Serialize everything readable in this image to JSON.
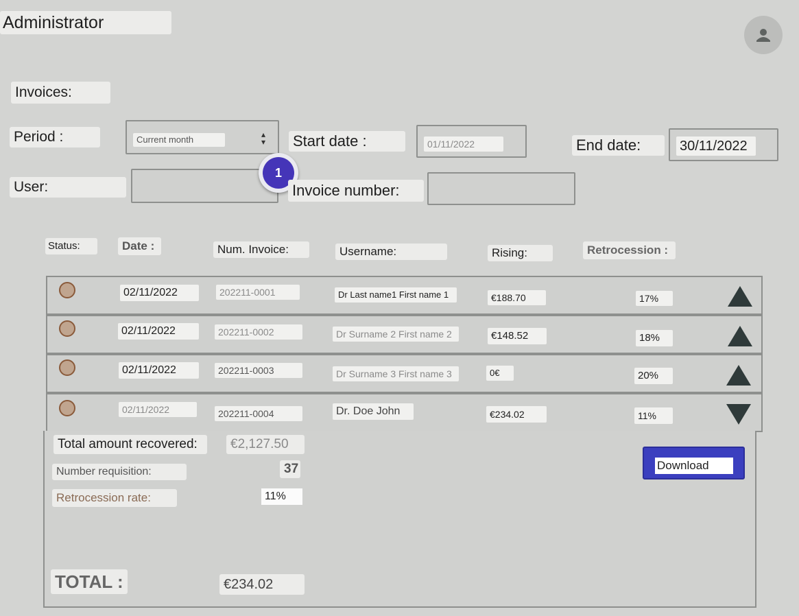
{
  "header": {
    "title": "Administrator",
    "avatar_icon": "user-icon"
  },
  "section_title": "Invoices:",
  "filters": {
    "period_label": "Period :",
    "period_value": "Current month",
    "start_label": "Start date :",
    "start_value": "01/11/2022",
    "end_label": "End date:",
    "end_value": "30/11/2022",
    "user_label": "User:",
    "user_value": "",
    "invoice_number_label": "Invoice number:",
    "invoice_number_value": ""
  },
  "step_badge": "1",
  "table": {
    "columns": {
      "status": "Status:",
      "date": "Date :",
      "num_invoice": "Num. Invoice:",
      "username": "Username:",
      "rising": "Rising:",
      "retrocession": "Retrocession :"
    },
    "rows": [
      {
        "date": "02/11/2022",
        "invoice": "202211-0001",
        "username": "Dr Last name1 First name 1",
        "rising": "€188.70",
        "retro": "17%",
        "arrow": "up"
      },
      {
        "date": "02/11/2022",
        "invoice": "202211-0002",
        "username": "Dr Surname 2 First name 2",
        "rising": "€148.52",
        "retro": "18%",
        "arrow": "up"
      },
      {
        "date": "02/11/2022",
        "invoice": "202211-0003",
        "username": "Dr Surname 3 First name 3",
        "rising": "0€",
        "retro": "20%",
        "arrow": "up"
      },
      {
        "date": "02/11/2022",
        "invoice": "202211-0004",
        "username": "Dr. Doe John",
        "rising": "€234.02",
        "retro": "11%",
        "arrow": "down"
      }
    ]
  },
  "summary": {
    "total_recovered_label": "Total amount recovered:",
    "total_recovered_value": "€2,127.50",
    "number_requisition_label": "Number requisition:",
    "number_requisition_value": "37",
    "retro_rate_label": "Retrocession rate:",
    "retro_rate_value": "11%",
    "download_label": "Download",
    "total_label": "TOTAL :",
    "total_value": "€234.02"
  }
}
